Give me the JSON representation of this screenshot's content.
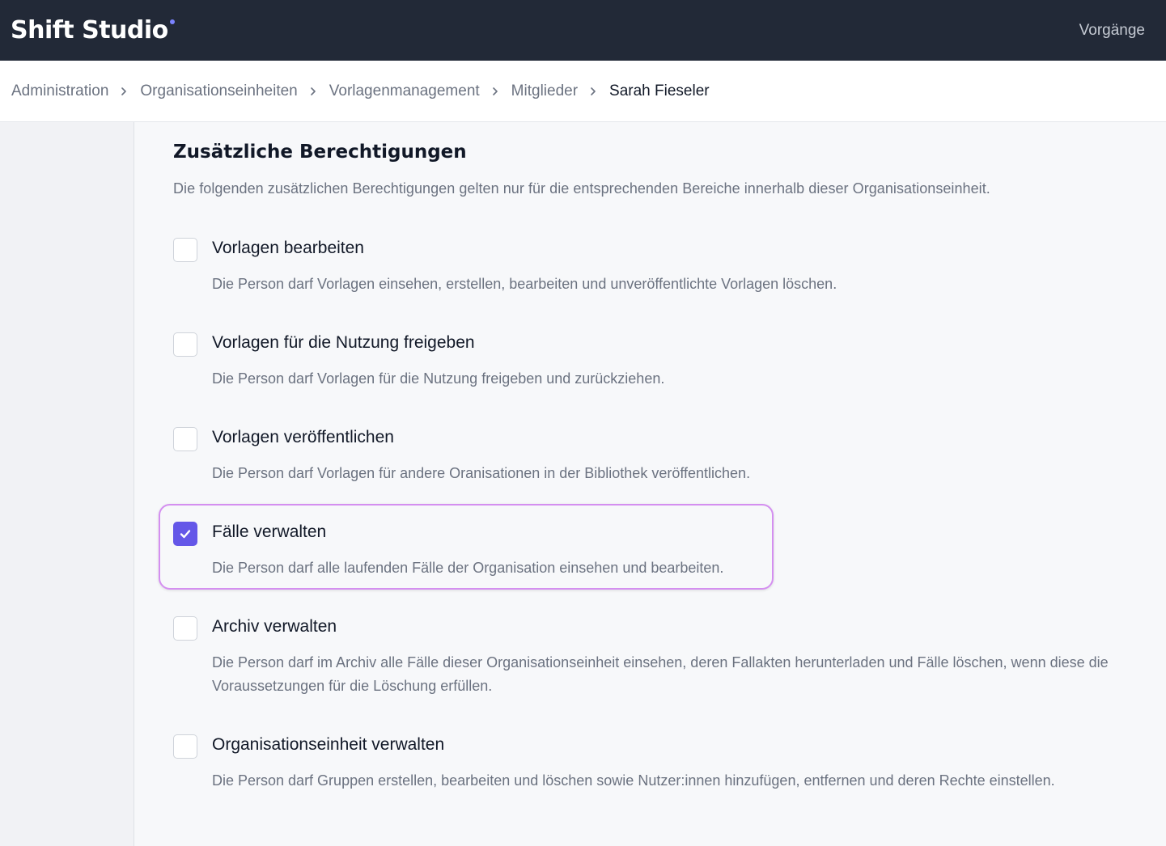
{
  "header": {
    "brand": "Shift Studio",
    "nav_item": "Vorgänge"
  },
  "breadcrumb": [
    {
      "label": "Administration"
    },
    {
      "label": "Organisationseinheiten"
    },
    {
      "label": "Vorlagenmanagement"
    },
    {
      "label": "Mitglieder"
    },
    {
      "label": "Sarah Fieseler"
    }
  ],
  "section": {
    "title": "Zusätzliche Berechtigungen",
    "description": "Die folgenden zusätzlichen Berechtigungen gelten nur für die entsprechenden Bereiche innerhalb dieser Organisationseinheit."
  },
  "permissions": [
    {
      "label": "Vorlagen bearbeiten",
      "description": "Die Person darf Vorlagen einsehen, erstellen, bearbeiten und unveröffentlichte Vorlagen löschen.",
      "checked": false
    },
    {
      "label": "Vorlagen für die Nutzung freigeben",
      "description": "Die Person darf Vorlagen für die Nutzung freigeben und zurückziehen.",
      "checked": false
    },
    {
      "label": "Vorlagen veröffentlichen",
      "description": "Die Person darf Vorlagen für andere Oranisationen in der Bibliothek veröffentlichen.",
      "checked": false
    },
    {
      "label": "Fälle verwalten",
      "description": "Die Person darf alle laufenden Fälle der Organisation einsehen und bearbeiten.",
      "checked": true
    },
    {
      "label": "Archiv verwalten",
      "description": "Die Person darf im Archiv alle Fälle dieser Organisationseinheit einsehen, deren Fallakten herunterladen und Fälle löschen, wenn diese die Voraussetzungen für die Löschung erfüllen.",
      "checked": false
    },
    {
      "label": "Organisationseinheit verwalten",
      "description": "Die Person darf Gruppen erstellen, bearbeiten und löschen sowie Nutzer:innen hinzufügen, entfernen und deren Rechte einstellen.",
      "checked": false
    }
  ],
  "colors": {
    "topbar": "#222937",
    "accent": "#6457e8",
    "focus_ring": "#d48ff0"
  }
}
